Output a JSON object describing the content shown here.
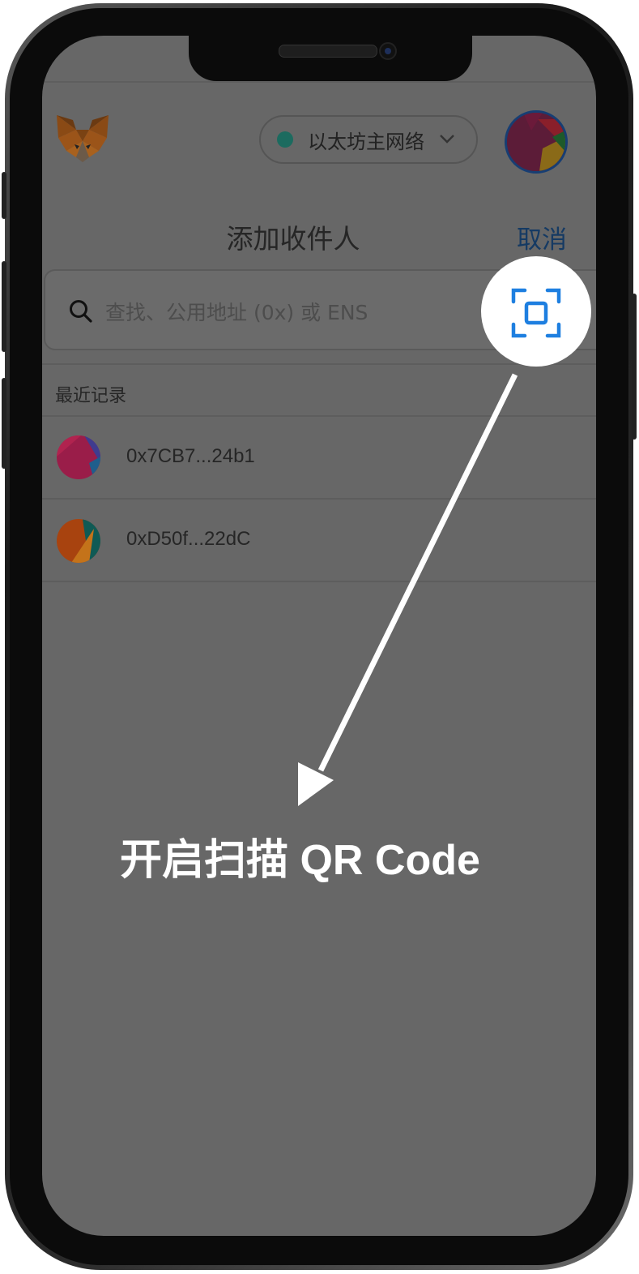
{
  "header": {
    "network": {
      "label": "以太坊主网络",
      "status_color": "#1c6b5f"
    }
  },
  "page": {
    "title": "添加收件人",
    "cancel_label": "取消"
  },
  "search": {
    "placeholder": "查找、公用地址 (0x) 或 ENS",
    "icon": "search-icon",
    "scan_icon": "qr-scan-icon"
  },
  "recent": {
    "label": "最近记录",
    "items": [
      {
        "address": "0x7CB7...24b1"
      },
      {
        "address": "0xD50f...22dC"
      }
    ]
  },
  "callout": {
    "text": "开启扫描 QR Code"
  },
  "colors": {
    "accent": "#1e7fe0",
    "overlay": "#676767",
    "link": "#153a63"
  }
}
